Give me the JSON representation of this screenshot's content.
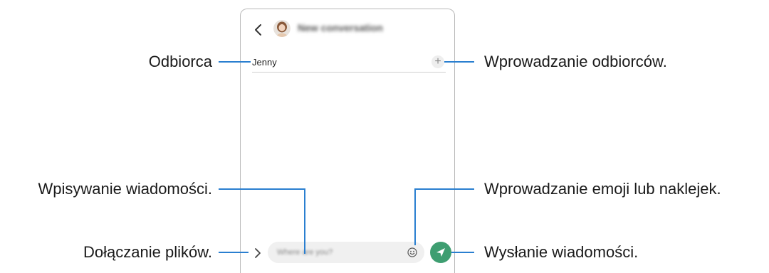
{
  "header": {
    "title": "New conversation",
    "back_icon": "chevron-left-icon",
    "avatar": "contact-avatar"
  },
  "recipient": {
    "name": "Jenny",
    "add_symbol": "+"
  },
  "composer": {
    "placeholder": "Where are you?",
    "attach_icon": "chevron-right-icon",
    "emoji_icon": "smiley-icon",
    "send_icon": "paper-plane-icon",
    "send_color": "#3e9e71"
  },
  "callouts": {
    "recipient": "Odbiorca",
    "enter_recipients": "Wprowadzanie odbiorców.",
    "type_message": "Wpisywanie wiadomości.",
    "emoji_stickers": "Wprowadzanie emoji lub naklejek.",
    "attach_files": "Dołączanie plików.",
    "send_message": "Wysłanie wiadomości."
  },
  "colors": {
    "callout_line": "#2a7fd0"
  }
}
